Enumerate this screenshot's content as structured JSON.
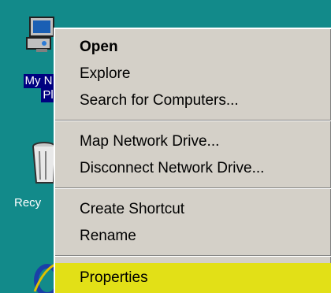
{
  "desktop": {
    "icons": [
      {
        "label_line1": "My N",
        "label_line2": "Pl",
        "icon": "my-computer-icon",
        "selected": true
      },
      {
        "label": "Recy",
        "icon": "recycle-bin-icon"
      },
      {
        "icon": "internet-explorer-icon"
      }
    ],
    "background_color": "#128a8a",
    "selection_color": "#000080"
  },
  "context_menu": {
    "items": [
      {
        "label": "Open",
        "bold": true
      },
      {
        "label": "Explore"
      },
      {
        "label": "Search for Computers..."
      },
      {
        "label": "Map Network Drive..."
      },
      {
        "label": "Disconnect Network Drive..."
      },
      {
        "label": "Create Shortcut"
      },
      {
        "label": "Rename"
      },
      {
        "label": "Properties",
        "highlighted": true
      }
    ],
    "highlight_color": "#e2e017",
    "background_color": "#d4d0c8"
  }
}
